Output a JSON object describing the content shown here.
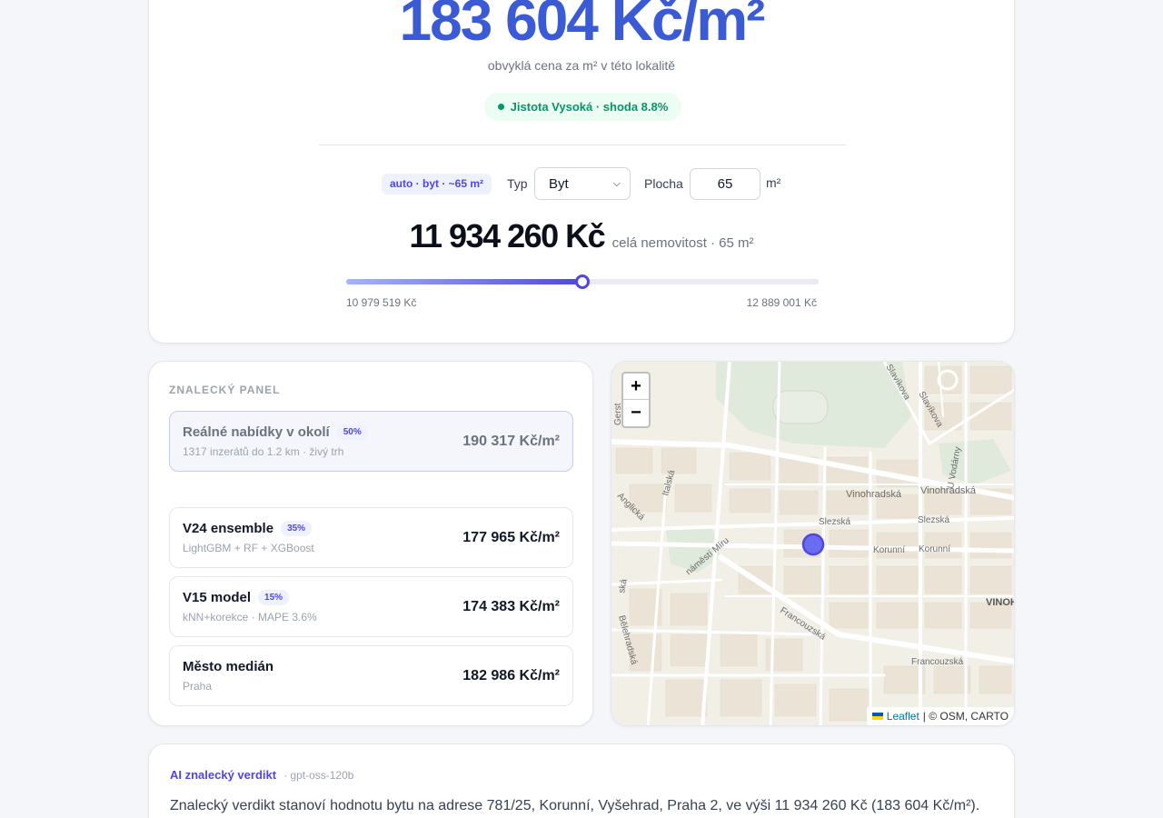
{
  "hero": {
    "price_per_m2": "183 604 Kč/m²",
    "subtitle": "obvyklá cena za m² v této lokalitě",
    "confidence_label": "Jistota Vysoká · shoda 8.8%",
    "accent_color": "#3b5bd6"
  },
  "controls": {
    "auto_badge": "auto · byt · ~65 m²",
    "type_label": "Typ",
    "type_value": "Byt",
    "area_label": "Plocha",
    "area_value": "65",
    "area_unit": "m²"
  },
  "total": {
    "price": "11 934 260 Kč",
    "subtitle": "celá nemovitost · 65 m²"
  },
  "range": {
    "low": "10 979 519 Kč",
    "high": "12 889 001 Kč",
    "position_fraction": 0.5
  },
  "panel": {
    "title": "ZNALECKÝ PANEL",
    "sources": [
      {
        "name": "Reálné nabídky v okolí",
        "weight": "50%",
        "desc": "1317 inzerátů do 1.2 km · živý trh",
        "value": "190 317 Kč/m²"
      },
      {
        "name": "V24 ensemble",
        "weight": "35%",
        "desc": "LightGBM + RF + XGBoost",
        "value": "177 965 Kč/m²"
      },
      {
        "name": "V15 model",
        "weight": "15%",
        "desc": "kNN+korekce · MAPE 3.6%",
        "value": "174 383 Kč/m²"
      },
      {
        "name": "Město medián",
        "weight": "",
        "desc": "Praha",
        "value": "182 986 Kč/m²"
      }
    ]
  },
  "map": {
    "zoom_in": "+",
    "zoom_out": "−",
    "attribution_link": "Leaflet",
    "attribution_rest": "| © OSM, CARTO",
    "streets": {
      "vinohradska_1": "Vinohradská",
      "vinohradska_2": "Vinohradská",
      "slezska_1": "Slezská",
      "slezska_2": "Slezská",
      "korunni_1": "Korunní",
      "korunni_2": "Korunní",
      "namesti_miru": "náměstí Míru",
      "francouzska_1": "Francouzská",
      "francouzska_2": "Francouzská",
      "italska": "Italská",
      "anglicka": "Anglická",
      "belehradska": "Bělehradská",
      "slavikova_1": "Slavíkova",
      "slavikova_2": "Slavíkova",
      "u_vodarny": "U Vodárny",
      "vinohrady": "VINOH",
      "gerstn": "Gerst",
      "ska": "ská"
    }
  },
  "ai": {
    "title": "AI znalecký verdikt",
    "model": "· gpt-oss-120b",
    "text": "Znalecký verdikt stanoví hodnotu bytu na adrese 781/25, Korunní, Vyšehrad, Praha 2, ve výši 11 934 260 Kč (183 604 Kč/m²)."
  }
}
